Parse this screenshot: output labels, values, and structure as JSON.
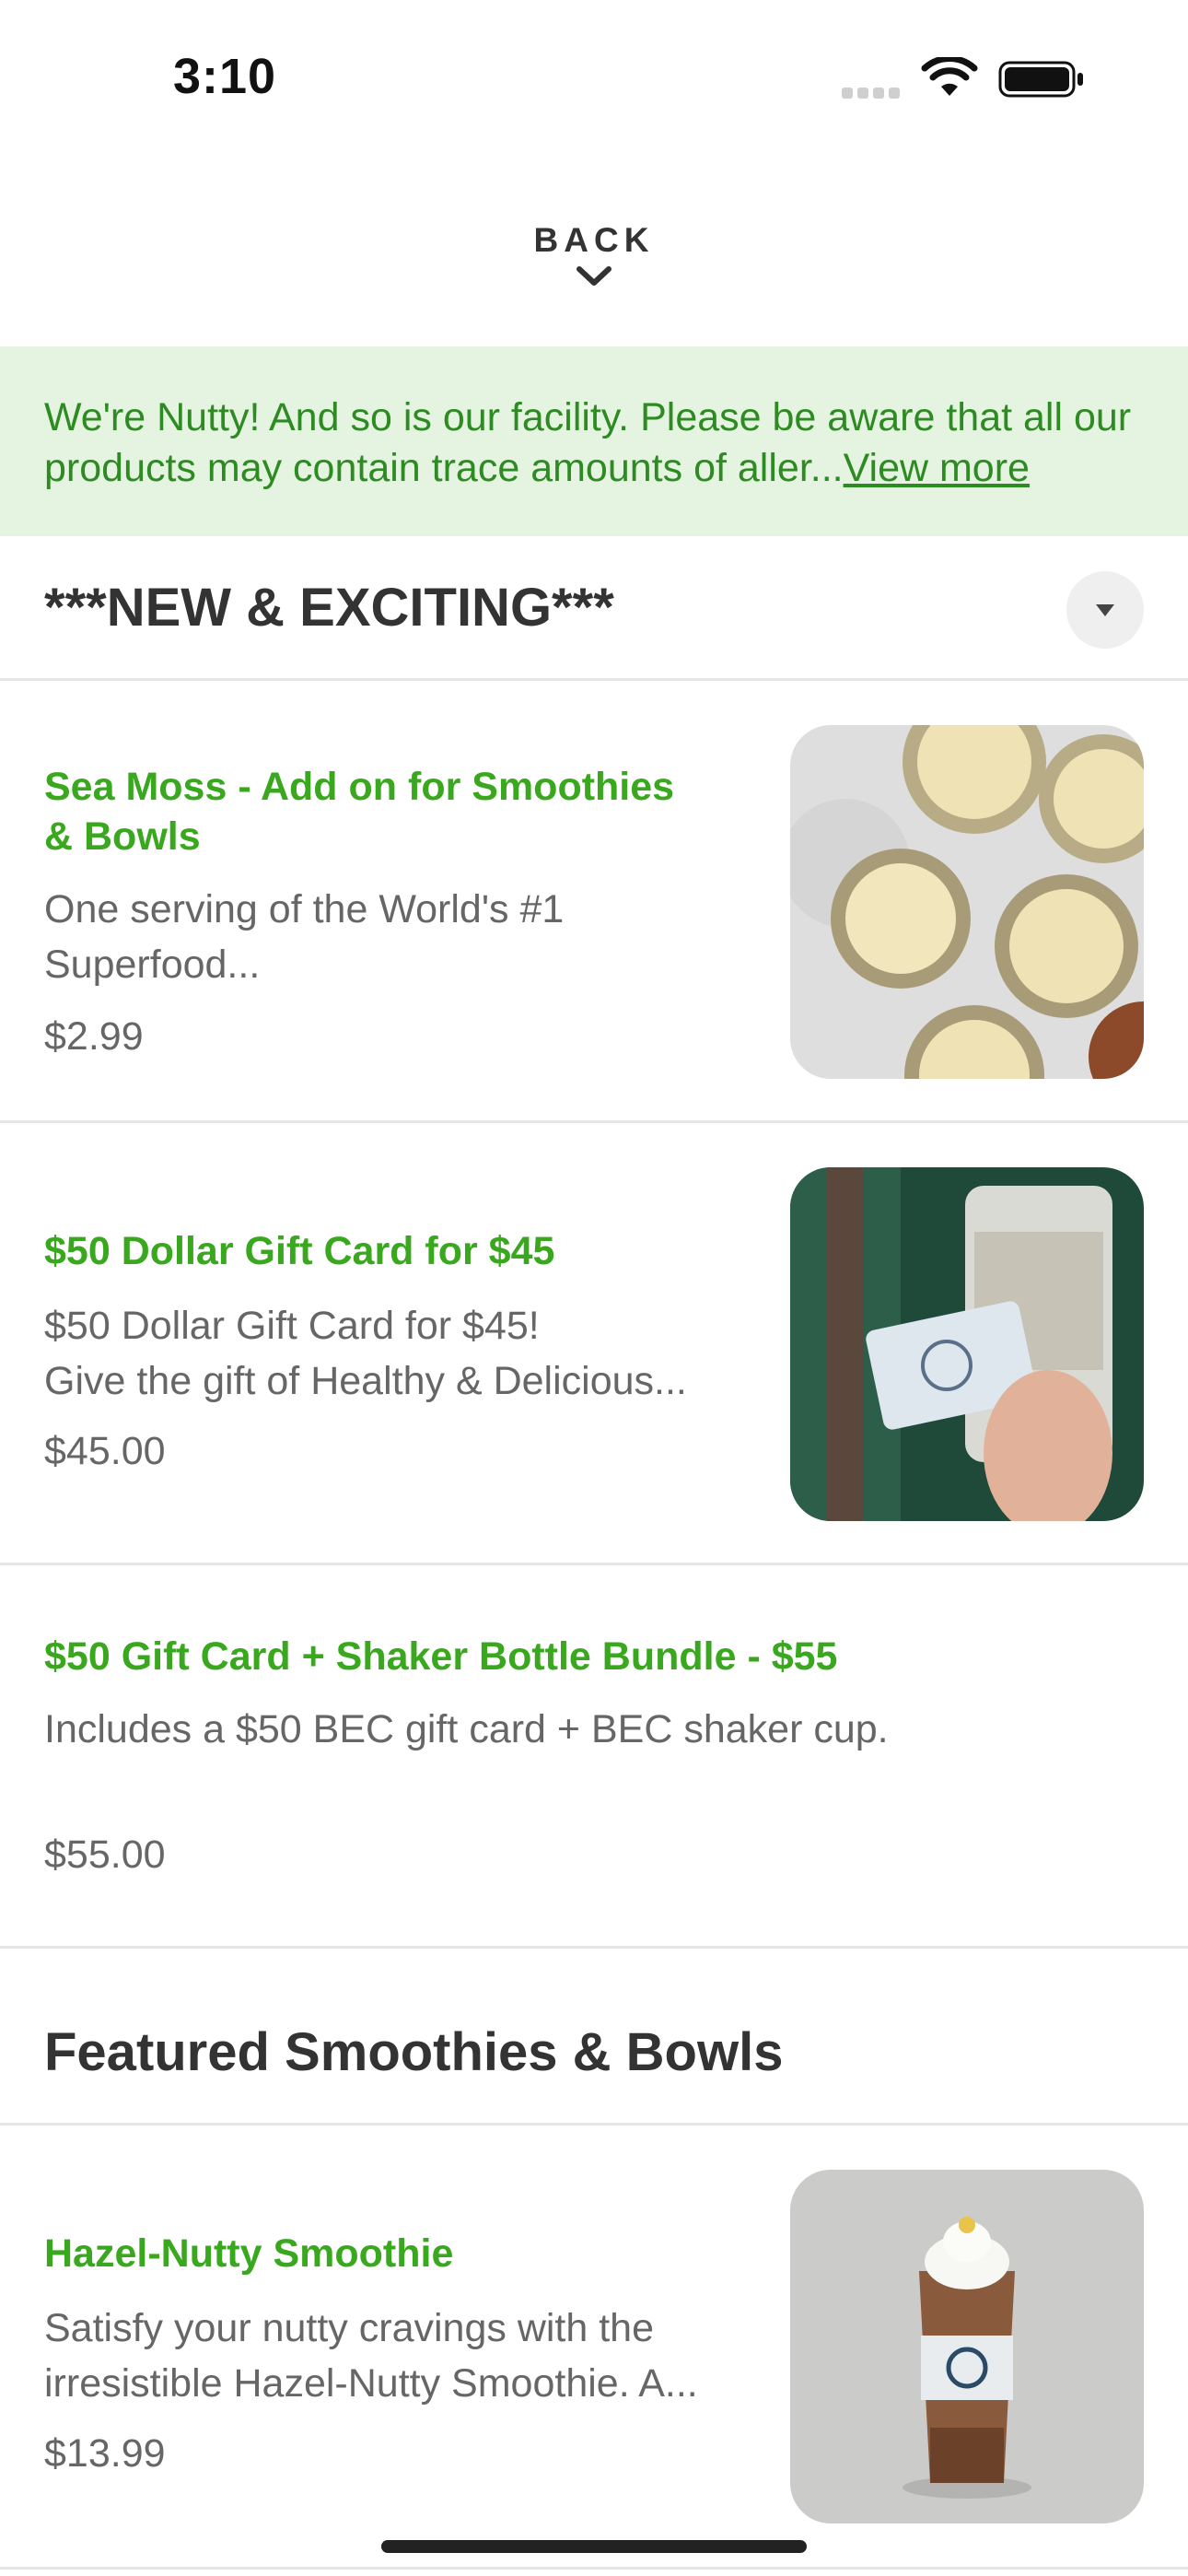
{
  "status_bar": {
    "time": "3:10"
  },
  "back": {
    "label": "BACK"
  },
  "allergen_notice": {
    "text": "We're Nutty! And so is our facility. Please be aware that all our products may contain trace amounts of aller...",
    "link": "View more"
  },
  "sections": [
    {
      "title": "***NEW & EXCITING***",
      "items": [
        {
          "title_lines": [
            "Sea Moss - Add on for Smoothies",
            "& Bowls"
          ],
          "desc_lines": [
            "One serving of the World's #1",
            "Superfood..."
          ],
          "price": "$2.99",
          "image": "sea-moss-jars"
        },
        {
          "title_lines": [
            "$50 Dollar Gift Card for $45"
          ],
          "desc_lines": [
            "$50 Dollar Gift Card for $45!",
            "Give the gift of Healthy & Delicious..."
          ],
          "price": "$45.00",
          "image": "gift-card-with-smoothie"
        },
        {
          "title_lines": [
            "$50 Gift Card + Shaker Bottle Bundle - $55"
          ],
          "desc_lines": [
            "Includes a $50 BEC gift card + BEC shaker cup."
          ],
          "price": "$55.00"
        }
      ]
    },
    {
      "title": "Featured Smoothies & Bowls",
      "items": [
        {
          "title_lines": [
            "Hazel-Nutty Smoothie"
          ],
          "desc_lines": [
            "Satisfy your nutty cravings with the",
            "irresistible Hazel-Nutty Smoothie. A..."
          ],
          "price": "$13.99",
          "image": "hazel-nutty-smoothie-cup"
        }
      ]
    }
  ],
  "colors": {
    "accent_green": "#3aa81f",
    "notice_bg": "#e4f4e0",
    "notice_text": "#2e8a22"
  }
}
